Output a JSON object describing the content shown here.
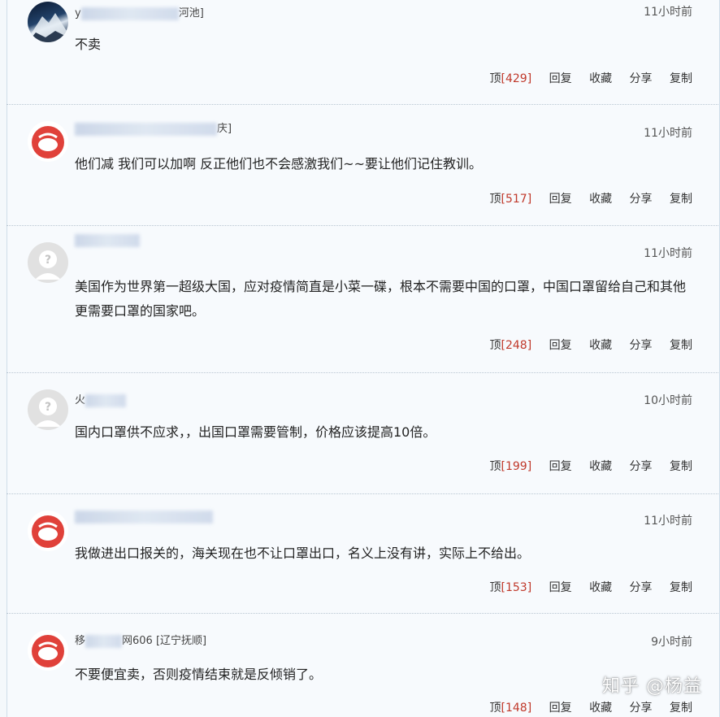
{
  "comments": [
    {
      "avatar": "mountain-photo",
      "username_visible": "y",
      "username_suffix": "河池]",
      "time": "11小时前",
      "content": "不卖",
      "actions": {
        "up": "顶",
        "up_count": "[429]",
        "reply": "回复",
        "fav": "收藏",
        "share": "分享",
        "copy": "复制"
      }
    },
    {
      "avatar": "red-logo",
      "username_visible": "",
      "username_suffix": "庆]",
      "time": "11小时前",
      "content": "他们减 我们可以加啊 反正他们也不会感激我们~~要让他们记住教训。",
      "actions": {
        "up": "顶",
        "up_count": "[517]",
        "reply": "回复",
        "fav": "收藏",
        "share": "分享",
        "copy": "复制"
      }
    },
    {
      "avatar": "default-gray",
      "username_visible": "",
      "username_suffix": "",
      "time": "11小时前",
      "content": "美国作为世界第一超级大国，应对疫情简直是小菜一碟，根本不需要中国的口罩，中国口罩留给自己和其他更需要口罩的国家吧。",
      "actions": {
        "up": "顶",
        "up_count": "[248]",
        "reply": "回复",
        "fav": "收藏",
        "share": "分享",
        "copy": "复制"
      }
    },
    {
      "avatar": "default-gray",
      "username_visible": "火",
      "username_suffix": "",
      "time": "10小时前",
      "content": "国内口罩供不应求，，出国口罩需要管制，价格应该提高10倍。",
      "actions": {
        "up": "顶",
        "up_count": "[199]",
        "reply": "回复",
        "fav": "收藏",
        "share": "分享",
        "copy": "复制"
      }
    },
    {
      "avatar": "red-logo",
      "username_visible": "",
      "username_suffix": "",
      "time": "11小时前",
      "content": "我做进出口报关的，海关现在也不让口罩出口，名义上没有讲，实际上不给出。",
      "actions": {
        "up": "顶",
        "up_count": "[153]",
        "reply": "回复",
        "fav": "收藏",
        "share": "分享",
        "copy": "复制"
      }
    },
    {
      "avatar": "red-logo",
      "username_visible": "移",
      "username_suffix": "网606 [辽宁抚顺]",
      "time": "9小时前",
      "content": "不要便宜卖，否则疫情结束就是反倾销了。",
      "actions": {
        "up": "顶",
        "up_count": "[148]",
        "reply": "回复",
        "fav": "收藏",
        "share": "分享",
        "copy": "复制"
      }
    }
  ],
  "watermark": "知乎 @杨益",
  "colors": {
    "up_count": "#c0392b",
    "logo_red": "#e0413a",
    "background": "#f7fafd"
  }
}
